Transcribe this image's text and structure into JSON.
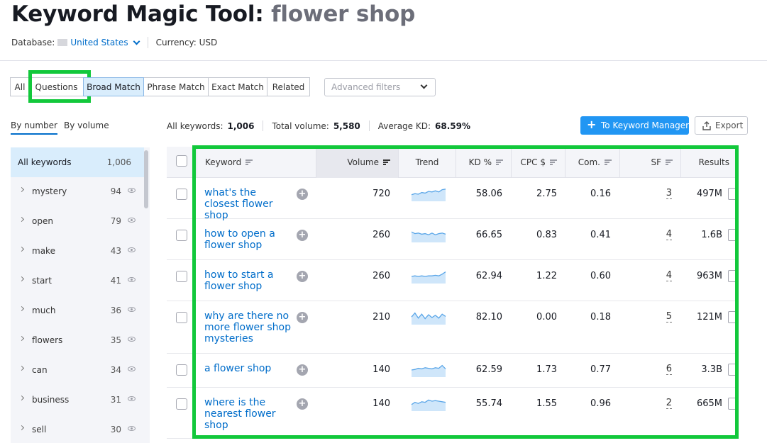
{
  "header": {
    "title": "Keyword Magic Tool:",
    "query": "flower shop",
    "database_label": "Database:",
    "database_value": "United States",
    "currency": "Currency: USD"
  },
  "match_tabs": [
    "All",
    "Questions",
    "Broad Match",
    "Phrase Match",
    "Exact Match",
    "Related"
  ],
  "active_tab": "Broad Match",
  "advanced_filters": "Advanced filters",
  "sidebar": {
    "tabs": [
      "By number",
      "By volume"
    ],
    "all_label": "All keywords",
    "all_count": "1,006",
    "items": [
      {
        "label": "mystery",
        "count": "94"
      },
      {
        "label": "open",
        "count": "79"
      },
      {
        "label": "make",
        "count": "43"
      },
      {
        "label": "start",
        "count": "41"
      },
      {
        "label": "much",
        "count": "36"
      },
      {
        "label": "flowers",
        "count": "35"
      },
      {
        "label": "can",
        "count": "34"
      },
      {
        "label": "business",
        "count": "31"
      },
      {
        "label": "sell",
        "count": "30"
      }
    ]
  },
  "stats": {
    "all_keywords_label": "All keywords:",
    "all_keywords_value": "1,006",
    "total_volume_label": "Total volume:",
    "total_volume_value": "5,580",
    "avg_kd_label": "Average KD:",
    "avg_kd_value": "68.59%"
  },
  "buttons": {
    "keyword_manager": "To Keyword Manager",
    "export": "Export"
  },
  "table": {
    "columns": [
      "Keyword",
      "Volume",
      "Trend",
      "KD %",
      "CPC $",
      "Com.",
      "SF",
      "Results"
    ],
    "rows": [
      {
        "keyword": "what's the closest flower shop",
        "volume": "720",
        "kd": "58.06",
        "cpc": "2.75",
        "com": "0.16",
        "sf": "3",
        "results": "497M",
        "trend": [
          0.55,
          0.45,
          0.5,
          0.35,
          0.4,
          0.25,
          0.3,
          0.2,
          0.3,
          0.1,
          0.05
        ]
      },
      {
        "keyword": "how to open a flower shop",
        "volume": "260",
        "kd": "66.65",
        "cpc": "0.83",
        "com": "0.41",
        "sf": "4",
        "results": "1.6B",
        "trend": [
          0.2,
          0.35,
          0.3,
          0.4,
          0.35,
          0.45,
          0.3,
          0.45,
          0.35,
          0.3,
          0.4
        ]
      },
      {
        "keyword": "how to start a flower shop",
        "volume": "260",
        "kd": "62.94",
        "cpc": "1.22",
        "com": "0.60",
        "sf": "4",
        "results": "963M",
        "trend": [
          0.5,
          0.45,
          0.5,
          0.45,
          0.5,
          0.45,
          0.45,
          0.4,
          0.45,
          0.3,
          0.1
        ]
      },
      {
        "keyword": "why are there no more flower shop mysteries",
        "volume": "210",
        "kd": "82.10",
        "cpc": "0.00",
        "com": "0.18",
        "sf": "5",
        "results": "121M",
        "trend": [
          0.45,
          0.1,
          0.55,
          0.2,
          0.6,
          0.25,
          0.5,
          0.3,
          0.55,
          0.2,
          0.4
        ]
      },
      {
        "keyword": "a flower shop",
        "volume": "140",
        "kd": "62.59",
        "cpc": "1.73",
        "com": "0.77",
        "sf": "6",
        "results": "3.3B",
        "trend": [
          0.5,
          0.45,
          0.35,
          0.4,
          0.3,
          0.35,
          0.4,
          0.3,
          0.35,
          0.1,
          0.4
        ]
      },
      {
        "keyword": "where is the nearest flower shop",
        "volume": "140",
        "kd": "55.74",
        "cpc": "1.55",
        "com": "0.96",
        "sf": "2",
        "results": "665M",
        "trend": [
          0.55,
          0.35,
          0.45,
          0.3,
          0.35,
          0.15,
          0.25,
          0.2,
          0.25,
          0.3,
          0.35
        ]
      }
    ]
  },
  "colors": {
    "accent": "#2196f3",
    "link": "#006dca",
    "highlight": "#12c83b",
    "active_tab_bg": "#d9edfc"
  }
}
